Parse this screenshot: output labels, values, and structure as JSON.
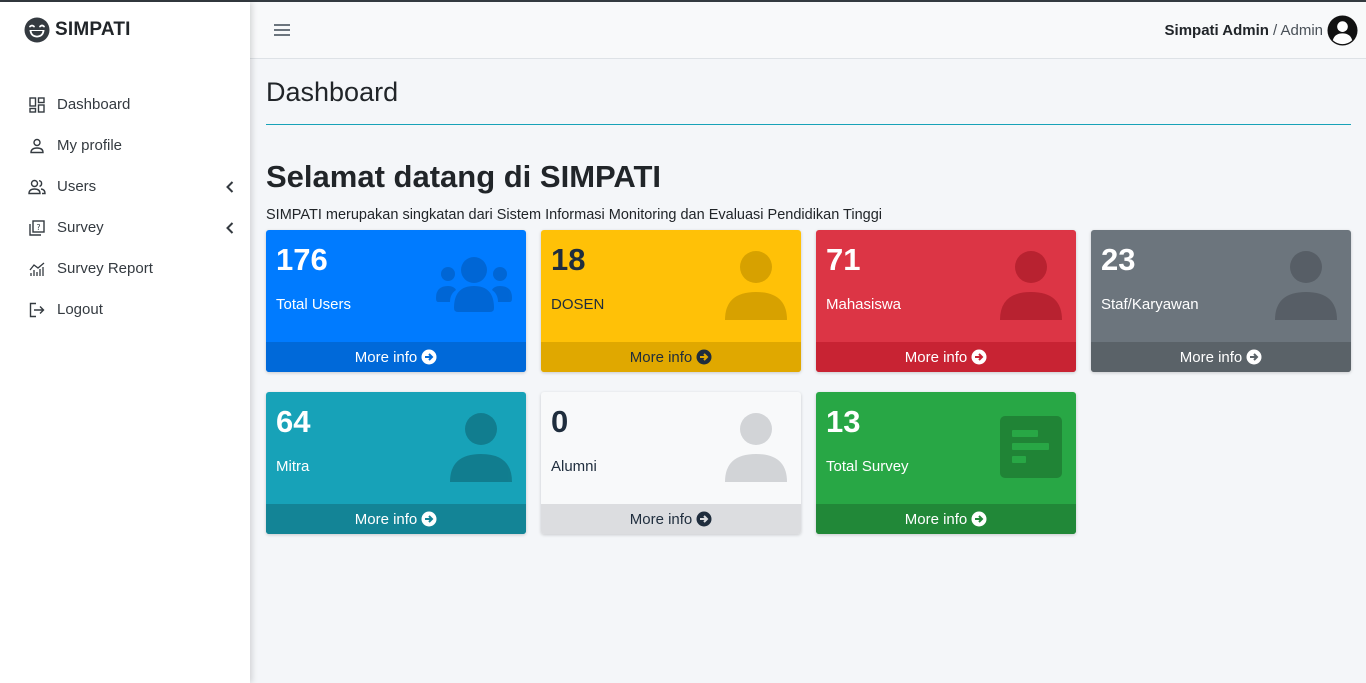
{
  "brand": {
    "name": "SIMPATI",
    "icon": "laughing-face-icon"
  },
  "sidebar": {
    "items": [
      {
        "label": "Dashboard",
        "icon": "dashboard-icon"
      },
      {
        "label": "My profile",
        "icon": "person-icon"
      },
      {
        "label": "Users",
        "icon": "users-icon",
        "has_submenu": true
      },
      {
        "label": "Survey",
        "icon": "survey-icon",
        "has_submenu": true
      },
      {
        "label": "Survey Report",
        "icon": "chart-icon"
      },
      {
        "label": "Logout",
        "icon": "logout-icon"
      }
    ]
  },
  "topbar": {
    "user_name": "Simpati Admin",
    "user_role": "/ Admin"
  },
  "main": {
    "page_title": "Dashboard",
    "welcome": "Selamat datang di SIMPATI",
    "subtitle": "SIMPATI merupakan singkatan dari Sistem Informasi Monitoring dan Evaluasi Pendidikan Tinggi",
    "cards": [
      {
        "value": "176",
        "label": "Total Users",
        "footer": "More info",
        "color": "#007bff",
        "icon": "users-icon"
      },
      {
        "value": "18",
        "label": "DOSEN",
        "footer": "More info",
        "color": "#ffc107",
        "icon": "user-icon"
      },
      {
        "value": "71",
        "label": "Mahasiswa",
        "footer": "More info",
        "color": "#dc3545",
        "icon": "user-icon"
      },
      {
        "value": "23",
        "label": "Staf/Karyawan",
        "footer": "More info",
        "color": "#6c757d",
        "icon": "user-icon"
      },
      {
        "value": "64",
        "label": "Mitra",
        "footer": "More info",
        "color": "#17a2b8",
        "icon": "user-icon"
      },
      {
        "value": "0",
        "label": "Alumni",
        "footer": "More info",
        "color": "#f8f9fa",
        "icon": "user-icon"
      },
      {
        "value": "13",
        "label": "Total Survey",
        "footer": "More info",
        "color": "#28a745",
        "icon": "poll-icon"
      }
    ]
  }
}
